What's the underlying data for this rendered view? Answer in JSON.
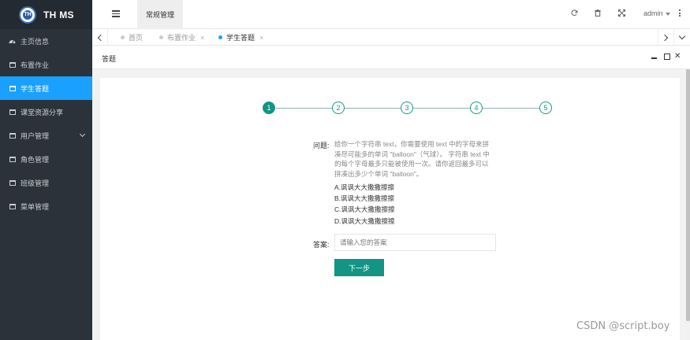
{
  "app": {
    "title": "TH MS",
    "logo_mark": "TH"
  },
  "sidebar": {
    "items": [
      {
        "label": "主页信息",
        "icon": "dashboard-icon"
      },
      {
        "label": "布置作业",
        "icon": "window-icon"
      },
      {
        "label": "学生答题",
        "icon": "window-icon",
        "active": true
      },
      {
        "label": "课堂资源分享",
        "icon": "window-icon"
      },
      {
        "label": "用户管理",
        "icon": "window-icon",
        "has_submenu": true
      },
      {
        "label": "角色管理",
        "icon": "window-icon"
      },
      {
        "label": "班级管理",
        "icon": "window-icon"
      },
      {
        "label": "菜单管理",
        "icon": "window-icon"
      }
    ]
  },
  "header": {
    "menu_toggle_icon": "hamburger-icon",
    "top_tab": "常规管理",
    "icons": [
      "refresh-icon",
      "trash-icon",
      "fullscreen-icon"
    ],
    "user": "admin",
    "more_icon": "vertical-dots-icon"
  },
  "tabs": [
    {
      "label": "首页",
      "closable": false,
      "active": false
    },
    {
      "label": "布置作业",
      "closable": true,
      "active": false
    },
    {
      "label": "学生答题",
      "closable": true,
      "active": true
    }
  ],
  "panel": {
    "title": "答题"
  },
  "steps": [
    "1",
    "2",
    "3",
    "4",
    "5"
  ],
  "current_step": 1,
  "question": {
    "label": "问题:",
    "text": "给你一个字符串 text，你需要使用 text 中的字母来拼凑尽可能多的单词 \"balloon\"（气球）。 字符串 text 中的每个字母最多只能被使用一次。请你返回最多可以拼凑出多少个单词 \"balloon\"。",
    "options": [
      "A.讽讽大大撒撒擦擦",
      "B.讽讽大大撒撒擦擦",
      "C.讽讽大大撒撒擦擦",
      "D.讽讽大大撒撒擦擦"
    ]
  },
  "answer": {
    "label": "答案:",
    "placeholder": "请输入您的答案",
    "value": ""
  },
  "next_button": "下一步",
  "watermark": "CSDN @script.boy",
  "colors": {
    "sidebar_bg": "#2b323a",
    "active_menu": "#1aa0ff",
    "primary": "#149484",
    "tab_active_dot": "#1e9fff"
  }
}
